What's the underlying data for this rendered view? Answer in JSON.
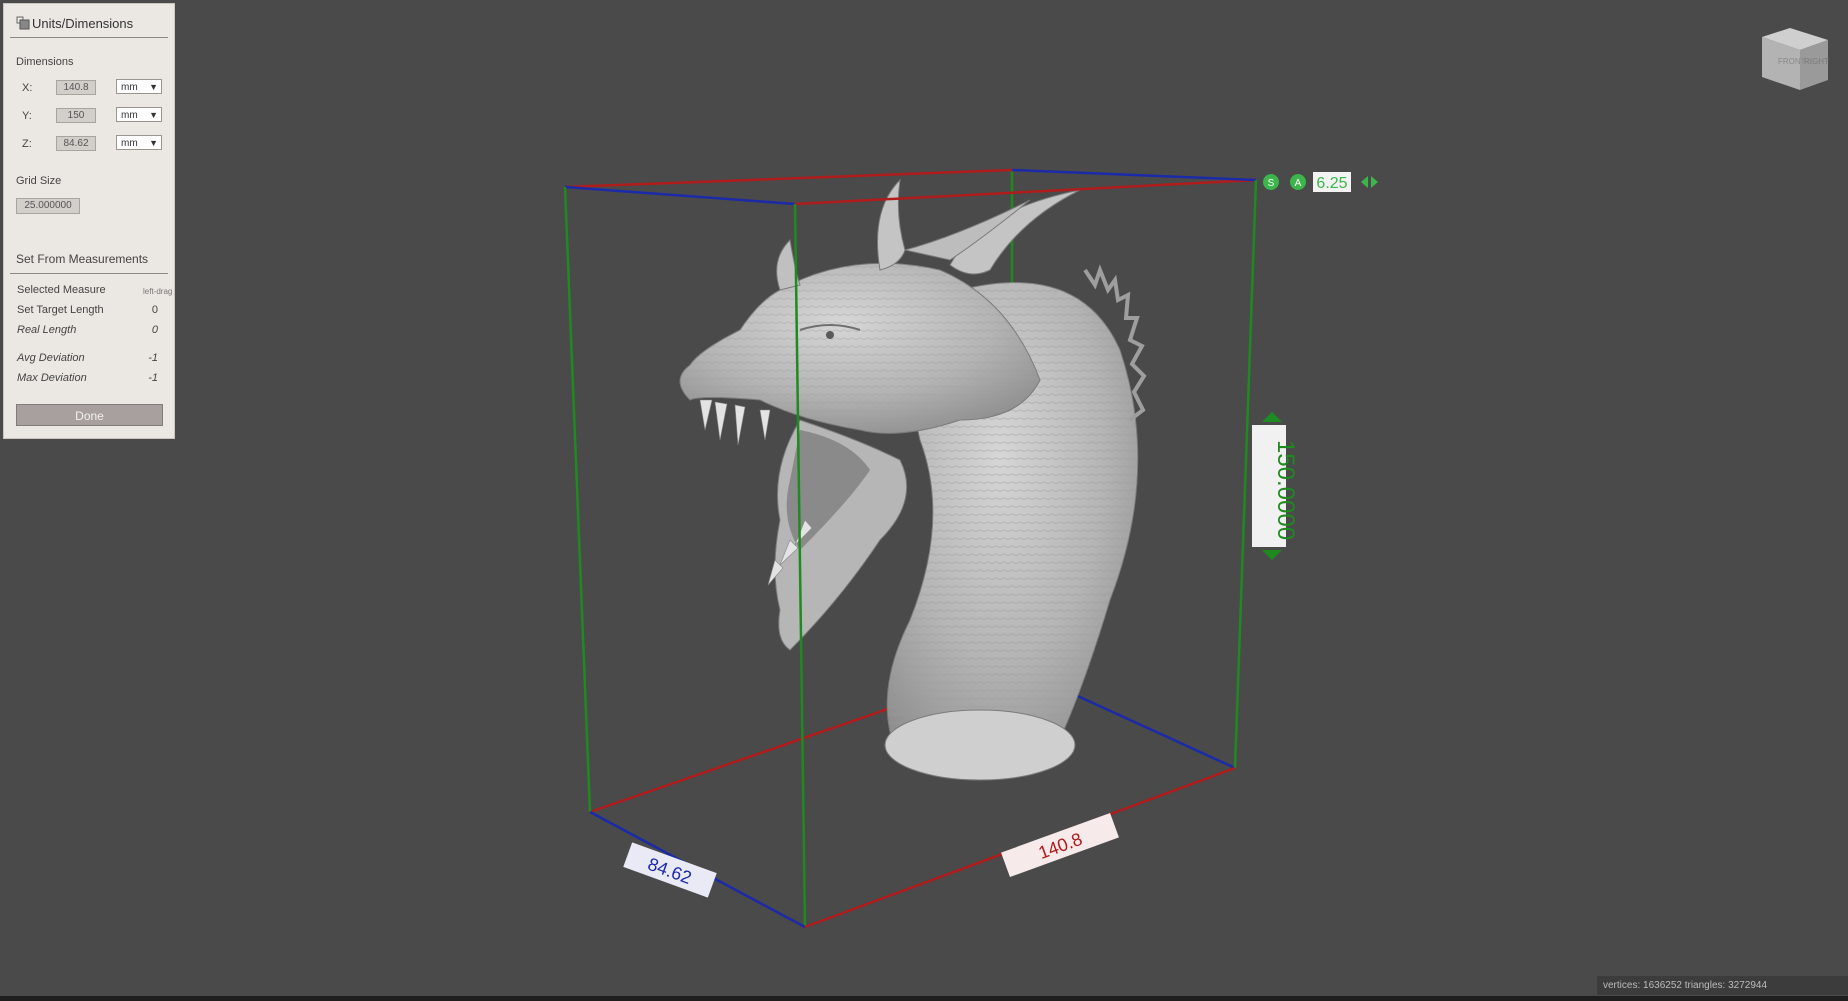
{
  "panel": {
    "title": "Units/Dimensions",
    "dimensions_label": "Dimensions",
    "rows": [
      {
        "axis": "X:",
        "value": "140.8",
        "unit": "mm"
      },
      {
        "axis": "Y:",
        "value": "150",
        "unit": "mm"
      },
      {
        "axis": "Z:",
        "value": "84.62",
        "unit": "mm"
      }
    ],
    "grid_size_label": "Grid Size",
    "grid_size_value": "25.000000",
    "set_from_measurements": "Set From Measurements",
    "selected_measure_label": "Selected Measure",
    "selected_measure_hint": "left-drag",
    "set_target_length_label": "Set Target Length",
    "set_target_length_value": "0",
    "real_length_label": "Real Length",
    "real_length_value": "0",
    "avg_deviation_label": "Avg Deviation",
    "avg_deviation_value": "-1",
    "max_deviation_label": "Max Deviation",
    "max_deviation_value": "-1",
    "done_label": "Done"
  },
  "viewcube": {
    "front_label": "FRONT",
    "right_label": "RIGHT"
  },
  "gizmo": {
    "s_label": "S",
    "a_label": "A",
    "snap_value": "6.25"
  },
  "dimension_labels": {
    "height": "150.0000",
    "width": "140.8",
    "depth": "84.62"
  },
  "status": {
    "text": "vertices: 1636252 triangles: 3272944"
  },
  "colors": {
    "background": "#4a4a4a",
    "x_axis": "#b01c1c",
    "y_axis": "#1f8a1f",
    "z_axis": "#1b2aa8",
    "model": "#b8b8b8",
    "gizmo_green": "#3cb54a"
  },
  "icons": [
    "panel-icon",
    "dropdown-arrow-icon",
    "view-cube-icon",
    "scale-handle-icon",
    "arrow-left-icon",
    "arrow-right-icon"
  ]
}
